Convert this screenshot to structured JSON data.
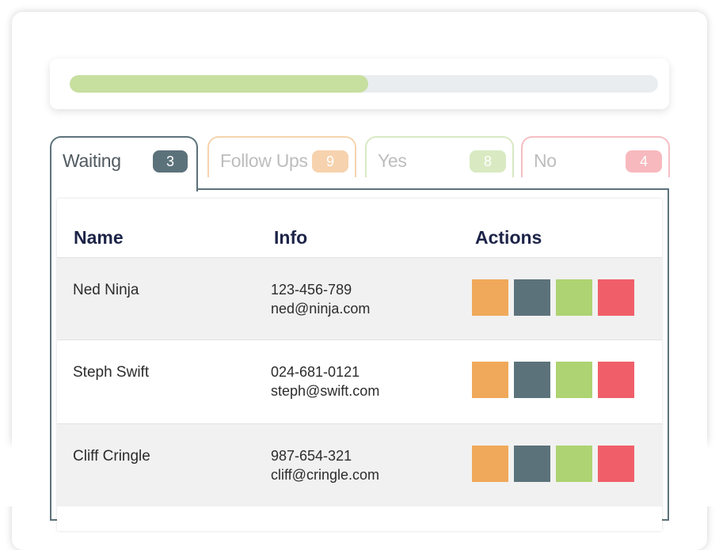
{
  "progress": {
    "fraction": 0.508,
    "fill_color": "#c7df9f",
    "track_color": "#e9edf0"
  },
  "tabs": [
    {
      "label": "Waiting",
      "count": "3",
      "active": true,
      "border_color": "#5c727a",
      "badge_color": "#5c727a",
      "text_color": "#505a60"
    },
    {
      "label": "Follow Ups",
      "count": "9",
      "active": false,
      "border_color": "#f6d3ad",
      "badge_color": "#f7d2ae",
      "text_color": "#bdbdbd"
    },
    {
      "label": "Yes",
      "count": "8",
      "active": false,
      "border_color": "#d8e9c3",
      "badge_color": "#d9eac2",
      "text_color": "#bdbdbd"
    },
    {
      "label": "No",
      "count": "4",
      "active": false,
      "border_color": "#f6bfc3",
      "badge_color": "#f7b9be",
      "text_color": "#bdbdbd"
    }
  ],
  "table": {
    "headers": {
      "name": "Name",
      "info": "Info",
      "actions": "Actions"
    },
    "rows": [
      {
        "name": "Ned Ninja",
        "phone": "123-456-789",
        "email": "ned@ninja.com"
      },
      {
        "name": "Steph Swift",
        "phone": "024-681-0121",
        "email": "steph@swift.com"
      },
      {
        "name": "Cliff Cringle",
        "phone": "987-654-321",
        "email": "cliff@cringle.com"
      }
    ],
    "row_backgrounds": [
      "#f1f1f1",
      "#ffffff",
      "#f1f1f1"
    ]
  },
  "actions": [
    {
      "name": "follow-up-action-button",
      "color": "#f0a95a"
    },
    {
      "name": "waiting-action-button",
      "color": "#5c727a"
    },
    {
      "name": "yes-action-button",
      "color": "#add372"
    },
    {
      "name": "no-action-button",
      "color": "#f05f69"
    }
  ]
}
